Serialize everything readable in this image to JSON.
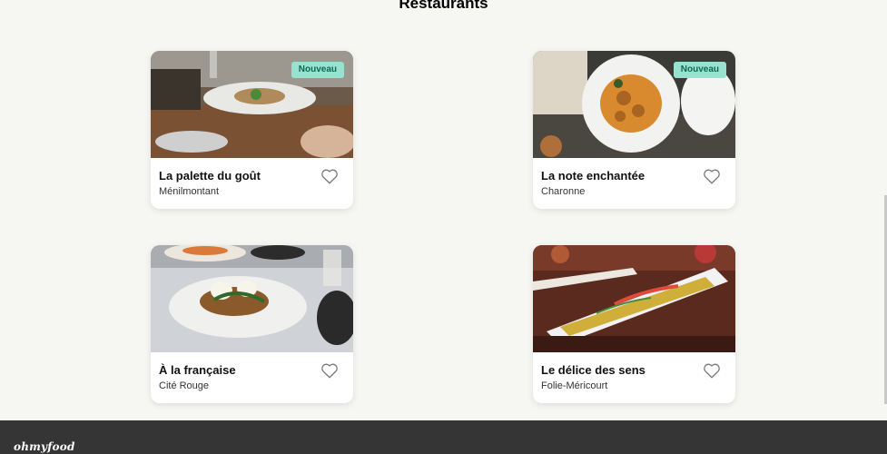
{
  "section": {
    "title": "Restaurants"
  },
  "cards": [
    {
      "name": "La palette du goût",
      "district": "Ménilmontant",
      "badge": "Nouveau"
    },
    {
      "name": "La note enchantée",
      "district": "Charonne",
      "badge": "Nouveau"
    },
    {
      "name": "À la française",
      "district": "Cité Rouge"
    },
    {
      "name": "Le délice des sens",
      "district": "Folie-Méricourt"
    }
  ],
  "footer": {
    "logo": "ohmyfood"
  },
  "colors": {
    "badge_bg": "#99e2d0",
    "badge_text": "#0a6b50",
    "footer_bg": "#353535",
    "page_bg": "#f6f6f2"
  },
  "icons": {
    "favorite": "heart-icon"
  }
}
